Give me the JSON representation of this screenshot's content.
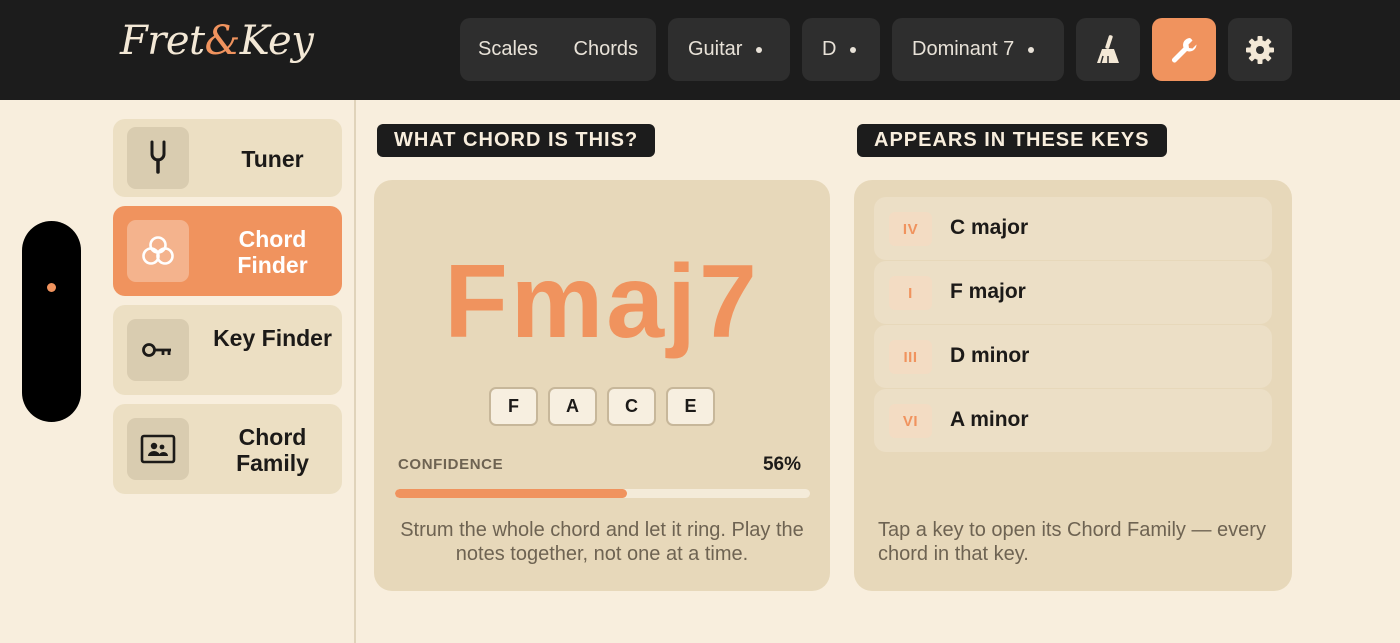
{
  "app": {
    "logo_left": "Fret",
    "logo_amp": "&",
    "logo_right": "Key"
  },
  "toolbar": {
    "tabs": [
      "Scales",
      "Chords"
    ],
    "instrument": "Guitar",
    "key": "D",
    "quality": "Dominant 7",
    "icons": [
      "broom-icon",
      "wrench-icon",
      "gear-icon"
    ],
    "active_icon": "wrench-icon"
  },
  "sidebar": {
    "items": [
      {
        "label": "Tuner",
        "icon": "tuning-fork-icon",
        "active": false
      },
      {
        "label": "Chord Finder",
        "icon": "circles-icon",
        "active": true
      },
      {
        "label": "Key Finder",
        "icon": "key-icon",
        "active": false
      },
      {
        "label": "Chord Family",
        "icon": "contact-card-icon",
        "active": false
      }
    ]
  },
  "chord_panel": {
    "header": "WHAT CHORD IS THIS?",
    "chord": "Fmaj7",
    "notes": [
      "F",
      "A",
      "C",
      "E"
    ],
    "confidence_label": "CONFIDENCE",
    "confidence_value": "56%",
    "confidence_fraction": 0.56,
    "hint": "Strum the whole chord and let it ring. Play the notes together, not one at a time."
  },
  "keys_panel": {
    "header": "APPEARS IN THESE KEYS",
    "keys": [
      {
        "numeral": "IV",
        "name": "C major"
      },
      {
        "numeral": "I",
        "name": "F major"
      },
      {
        "numeral": "III",
        "name": "D minor"
      },
      {
        "numeral": "VI",
        "name": "A minor"
      }
    ],
    "hint": "Tap a key to open its Chord Family — every chord in that key."
  },
  "colors": {
    "accent": "#f0935e",
    "background": "#f8eedd",
    "topbar": "#1c1c1c",
    "card": "#e7d8ba"
  }
}
